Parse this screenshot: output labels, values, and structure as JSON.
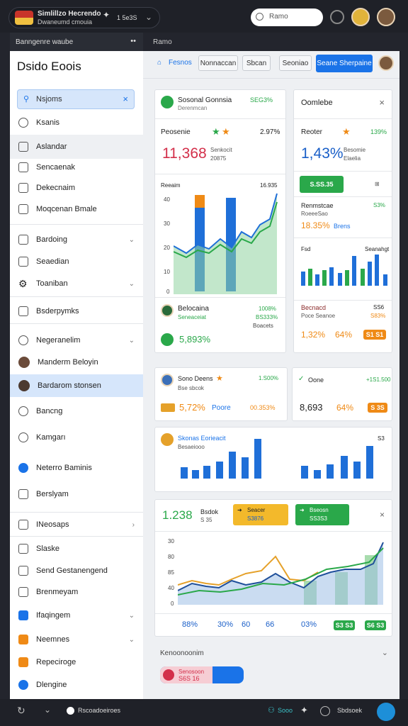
{
  "topbar": {
    "app_title": "Simlillzo Hecrendo",
    "app_subtitle": "Dwaneumd cmouia",
    "app_badge": "1 5e3S",
    "search_placeholder": "Ramo"
  },
  "sidebar": {
    "header": "Banngenre waube",
    "title": "Dsido Eoois",
    "search_text": "Nsjoms",
    "items": [
      {
        "label": "Ksanis"
      },
      {
        "label": "Aslandar"
      },
      {
        "label": "Sencaenak"
      },
      {
        "label": "Dekecnaim"
      },
      {
        "label": "Moqcenan Bmale"
      },
      {
        "label": "Bardoing"
      },
      {
        "label": "Seaedian"
      },
      {
        "label": "Toaniban"
      },
      {
        "label": "Bsderpymks"
      },
      {
        "label": "Negeranelim"
      },
      {
        "label": "Manderm Beloyin"
      },
      {
        "label": "Bardarom stonsen"
      },
      {
        "label": "Bancng"
      },
      {
        "label": "Kamgarı"
      },
      {
        "label": "Neterro Baminis"
      },
      {
        "label": "Berslyam"
      },
      {
        "label": "INeosaps"
      },
      {
        "label": "Slaske"
      },
      {
        "label": "Send Gestanengend"
      },
      {
        "label": "Brenmeyam"
      },
      {
        "label": "Ifaqingem"
      },
      {
        "label": "Neemnes"
      },
      {
        "label": "Repeciroge"
      },
      {
        "label": "Dlengine"
      }
    ]
  },
  "main": {
    "header_label": "Ramo",
    "tabs": [
      "Fesnos",
      "Nonnaccan",
      "Sbcan",
      "Seoniao",
      "Seane Sherpaine"
    ],
    "card1": {
      "title": "Sosonal Gonnsia",
      "title_value": "SEG3%",
      "subtitle": "Derenmcan",
      "label": "Peosenie",
      "pct": "2.97%",
      "big": "11,368",
      "big_sub1": "Senkocit",
      "big_sub2": "20875",
      "chart_label": "Reeaim",
      "chart_value": "16.935",
      "y_ticks": [
        "40",
        "30",
        "20",
        "10",
        "0"
      ],
      "footer_name": "Belocaina",
      "footer_sub": "Seneaceiat",
      "footer_v1": "1008%",
      "footer_v2": "BS333%",
      "footer_v3": "Boacets",
      "footer_big": "5,893%"
    },
    "card2": {
      "title": "Oomlebe",
      "label": "Reoter",
      "pct": "139%",
      "big": "1,43%",
      "big_sub1": "Besomie",
      "big_sub2": "Elaelia",
      "pill_value": "S.SS.35",
      "row_label": "Renmstcae",
      "row_sub": "RoeeeSao",
      "row_value": "S3%",
      "row_pct": "18.35%",
      "row_name": "Brens",
      "chart_left": "Fsd",
      "chart_right": "Seanahgt",
      "foot_label": "Becnacd",
      "foot_sub": "Poce Seanoe",
      "foot_v1": "SS6",
      "foot_v2": "S83%",
      "foot_a": "1,32%",
      "foot_b": "64%",
      "foot_pill": "S1 S1"
    },
    "card3": {
      "title": "Sono Deens",
      "value": "1.S00%",
      "sub": "Bse sbcok",
      "pct": "5,72%",
      "name": "Poore",
      "right": "00.353%"
    },
    "card4": {
      "title": "Oone",
      "value": "+1S1.500",
      "big": "8,693",
      "pct": "64%",
      "pill": "S 3S"
    },
    "card5": {
      "title": "Skonas Eorieacit",
      "sub": "Besaeiooo",
      "right": "S3"
    },
    "card6": {
      "big": "1.238",
      "name": "Bsdok",
      "sub": "S 35",
      "pill1_a": "Seacer",
      "pill1_b": "S3876",
      "pill2_a": "Bseosn",
      "pill2_b": "SS3S3",
      "y_ticks": [
        "30",
        "80",
        "85",
        "40",
        "0"
      ],
      "foot": [
        "88%",
        "30%",
        "60",
        "66",
        "03%"
      ],
      "pill3": "S3 S3",
      "pill4": "S6 S3"
    },
    "section_label": "Kenoonoonim",
    "progress_label": "Senosoon",
    "progress_value": "S6S 16"
  },
  "bottombar": {
    "status": "Rscoadoeiroes",
    "mid": "Sooo",
    "right": "Sbdsoek"
  },
  "colors": {
    "accent": "#1a73e8",
    "green": "#2aa84a",
    "orange": "#ef8a16",
    "red": "#d32f4a",
    "dark": "#1f2128"
  }
}
